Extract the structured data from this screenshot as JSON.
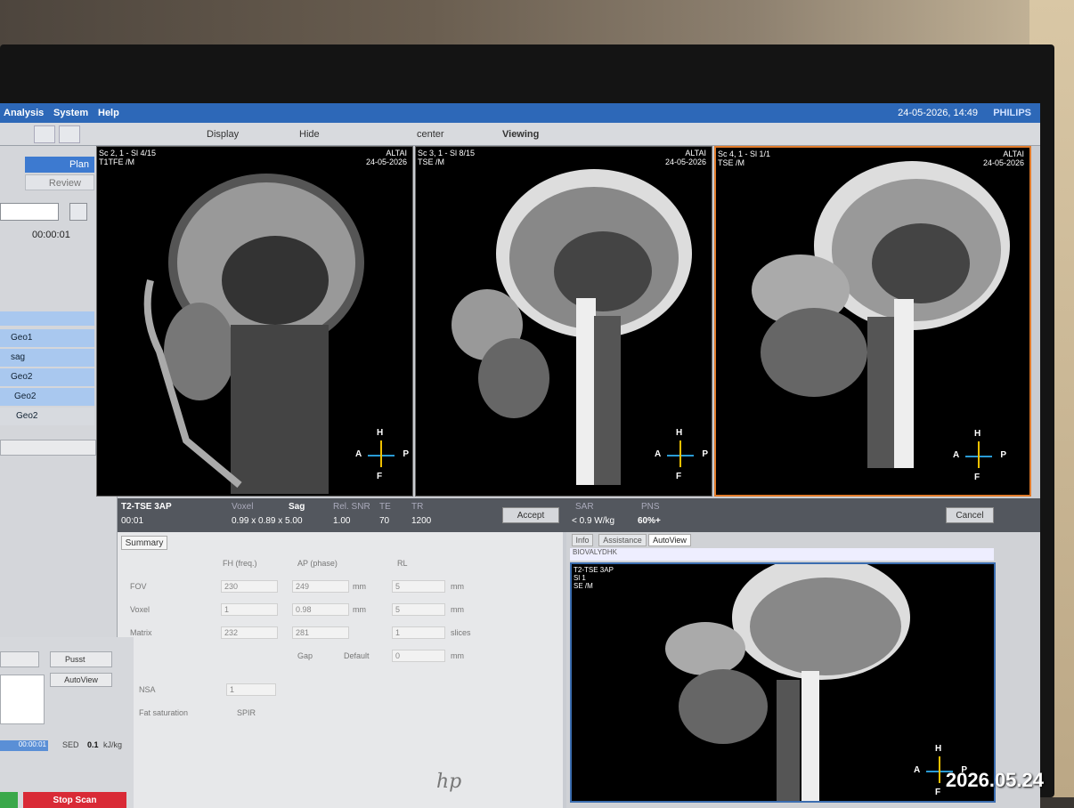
{
  "menu": {
    "items": [
      "Analysis",
      "System",
      "Help"
    ],
    "datetime": "24-05-2026, 14:49",
    "brand": "PHILIPS"
  },
  "toolbar": {
    "display": "Display",
    "hide": "Hide",
    "center": "center",
    "viewing": "Viewing"
  },
  "left": {
    "plan": "Plan",
    "review": "Review",
    "timer": "00:00:01",
    "items": [
      "Geo1",
      "sag",
      "Geo2",
      "Geo2",
      "Geo2"
    ],
    "preset": "Pusst",
    "autoview": "AutoView",
    "progress": "00:00:01",
    "sed_label": "SED",
    "sed_value": "0.1",
    "sed_unit": "kJ/kg",
    "stop": "Stop Scan"
  },
  "viewers": [
    {
      "line1": "Sc 2, 1 - Sl 4/15",
      "line2": "T1TFE  /M",
      "patient": "ALTAI",
      "date": "24-05-2026"
    },
    {
      "line1": "Sc 3, 1 - Sl 8/15",
      "line2": "TSE  /M",
      "patient": "ALTAI",
      "date": "24-05-2026"
    },
    {
      "line1": "Sc 4, 1 - Sl 1/1",
      "line2": "TSE  /M",
      "patient": "ALTAI",
      "date": "24-05-2026"
    }
  ],
  "orient": {
    "h": "H",
    "f": "F",
    "a": "A",
    "p": "P"
  },
  "scan": {
    "name": "T2-TSE 3AP",
    "time": "00:01",
    "voxel_label": "Voxel",
    "voxel": "0.99 x 0.89 x 5.00",
    "orient": "Sag",
    "snr_label": "Rel. SNR",
    "snr": "1.00",
    "te_label": "TE",
    "te": "70",
    "tr_label": "TR",
    "tr": "1200",
    "accept": "Accept",
    "sar_label": "SAR",
    "sar": "< 0.9 W/kg",
    "pns_label": "PNS",
    "pns": "60%+",
    "cancel": "Cancel"
  },
  "params": {
    "tab": "Summary",
    "fh": "FH (freq.)",
    "ap": "AP (phase)",
    "rl": "RL",
    "fov_label": "FOV",
    "fov": [
      "230",
      "249",
      "5"
    ],
    "voxel_label": "Voxel",
    "voxel": [
      "1",
      "0.98",
      "5"
    ],
    "matrix_label": "Matrix",
    "matrix": [
      "232",
      "281",
      "1"
    ],
    "mm": "mm",
    "slices": "slices",
    "gap_label": "Gap",
    "default": "Default",
    "gap": "0",
    "nsa_label": "NSA",
    "nsa": "1",
    "fat_label": "Fat saturation",
    "spir": "SPIR"
  },
  "rightpanel": {
    "tabs": [
      "Info",
      "Assistance",
      "AutoView"
    ],
    "patient": "BIOVALYDHK",
    "overlay1": "T2-TSE 3AP",
    "overlay2": "Sl 1",
    "overlay3": "SE  /M"
  },
  "stamp": "2026.05.24",
  "bezel_logo": "hp"
}
